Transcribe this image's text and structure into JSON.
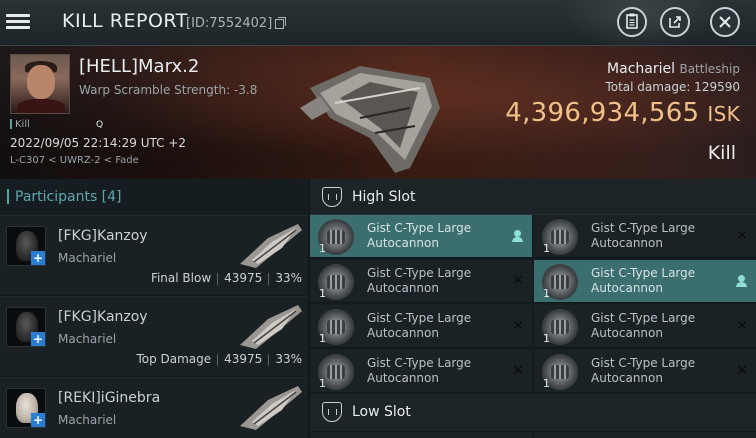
{
  "header": {
    "title": "KILL REPORT",
    "report_id": "[ID:7552402]",
    "icons": {
      "menu": "hamburger-menu-icon",
      "clipboard": "clipboard-icon",
      "share": "external-share-icon",
      "close": "close-icon"
    }
  },
  "victim": {
    "name": "[HELL]Marx.2",
    "warp_scramble": "Warp Scramble Strength: -3.8",
    "kill_tag": "Kill",
    "datetime": "2022/09/05 22:14:29 UTC +2",
    "location": "L-C307 < UWRZ-2 < Fade",
    "ship_name": "Machariel",
    "ship_class": "Battleship",
    "total_damage": "Total damage:  129590",
    "isk_value": "4,396,934,565",
    "isk_unit": "ISK",
    "status": "Kill"
  },
  "participants": {
    "title": "Participants [4]",
    "items": [
      {
        "name": "[FKG]Kanzoy",
        "ship": "Machariel",
        "role": "Final Blow",
        "damage": "43975",
        "percent": "33%"
      },
      {
        "name": "[FKG]Kanzoy",
        "ship": "Machariel",
        "role": "Top Damage",
        "damage": "43975",
        "percent": "33%"
      },
      {
        "name": "[REKI]iGinebra",
        "ship": "Machariel",
        "role": "",
        "damage": "",
        "percent": ""
      }
    ]
  },
  "slots": {
    "high": {
      "title": "High Slot",
      "modules": [
        {
          "line1": "Gist C-Type Large",
          "line2": "Autocannon",
          "qty": "1",
          "status": "pilot"
        },
        {
          "line1": "Gist C-Type Large",
          "line2": "Autocannon",
          "qty": "1",
          "status": "destroyed"
        },
        {
          "line1": "Gist C-Type Large",
          "line2": "Autocannon",
          "qty": "1",
          "status": "destroyed"
        },
        {
          "line1": "Gist C-Type Large",
          "line2": "Autocannon",
          "qty": "1",
          "status": "pilot"
        },
        {
          "line1": "Gist C-Type Large",
          "line2": "Autocannon",
          "qty": "1",
          "status": "destroyed"
        },
        {
          "line1": "Gist C-Type Large",
          "line2": "Autocannon",
          "qty": "1",
          "status": "destroyed"
        },
        {
          "line1": "Gist C-Type Large",
          "line2": "Autocannon",
          "qty": "1",
          "status": "destroyed"
        },
        {
          "line1": "Gist C-Type Large",
          "line2": "Autocannon",
          "qty": "1",
          "status": "destroyed"
        }
      ]
    },
    "low": {
      "title": "Low Slot"
    }
  }
}
